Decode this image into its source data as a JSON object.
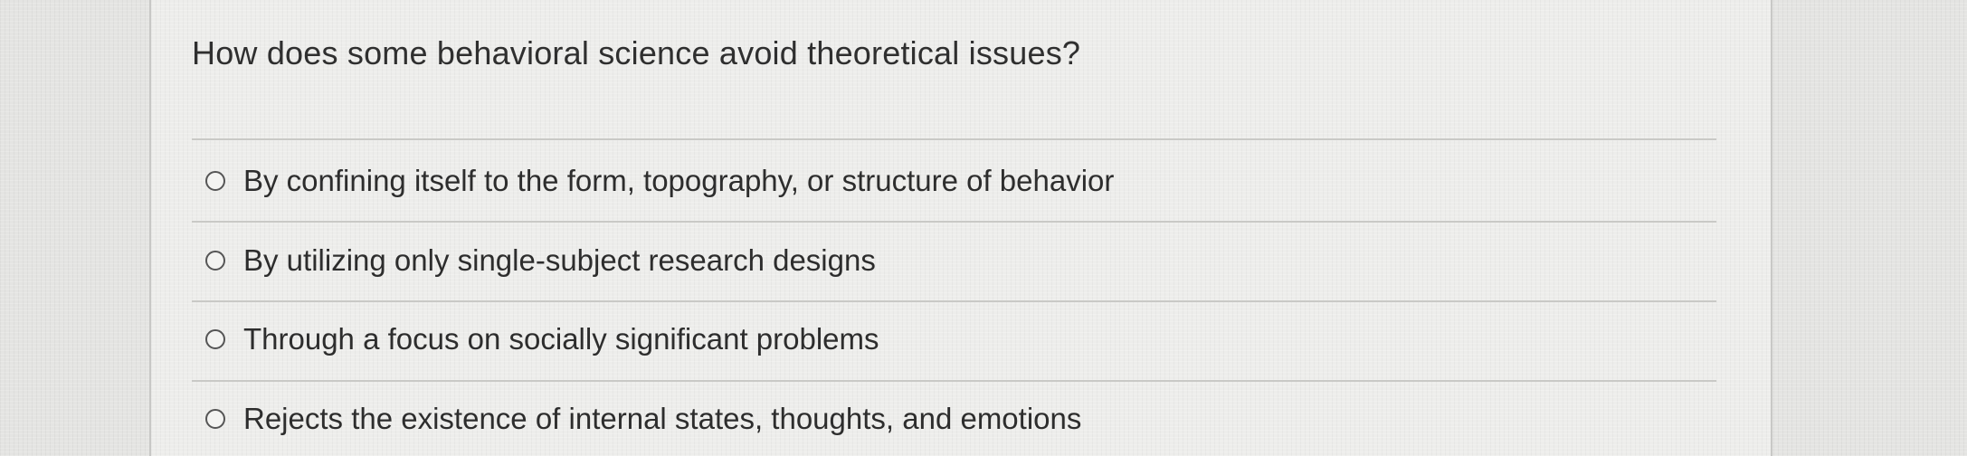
{
  "question": {
    "text": "How does some behavioral science avoid theoretical issues?"
  },
  "options": [
    {
      "label": "By confining itself to the form, topography, or structure of behavior",
      "selected": false
    },
    {
      "label": "By utilizing only single-subject research designs",
      "selected": false
    },
    {
      "label": "Through a focus on socially significant problems",
      "selected": false
    },
    {
      "label": "Rejects the existence of internal states, thoughts, and emotions",
      "selected": false
    }
  ]
}
